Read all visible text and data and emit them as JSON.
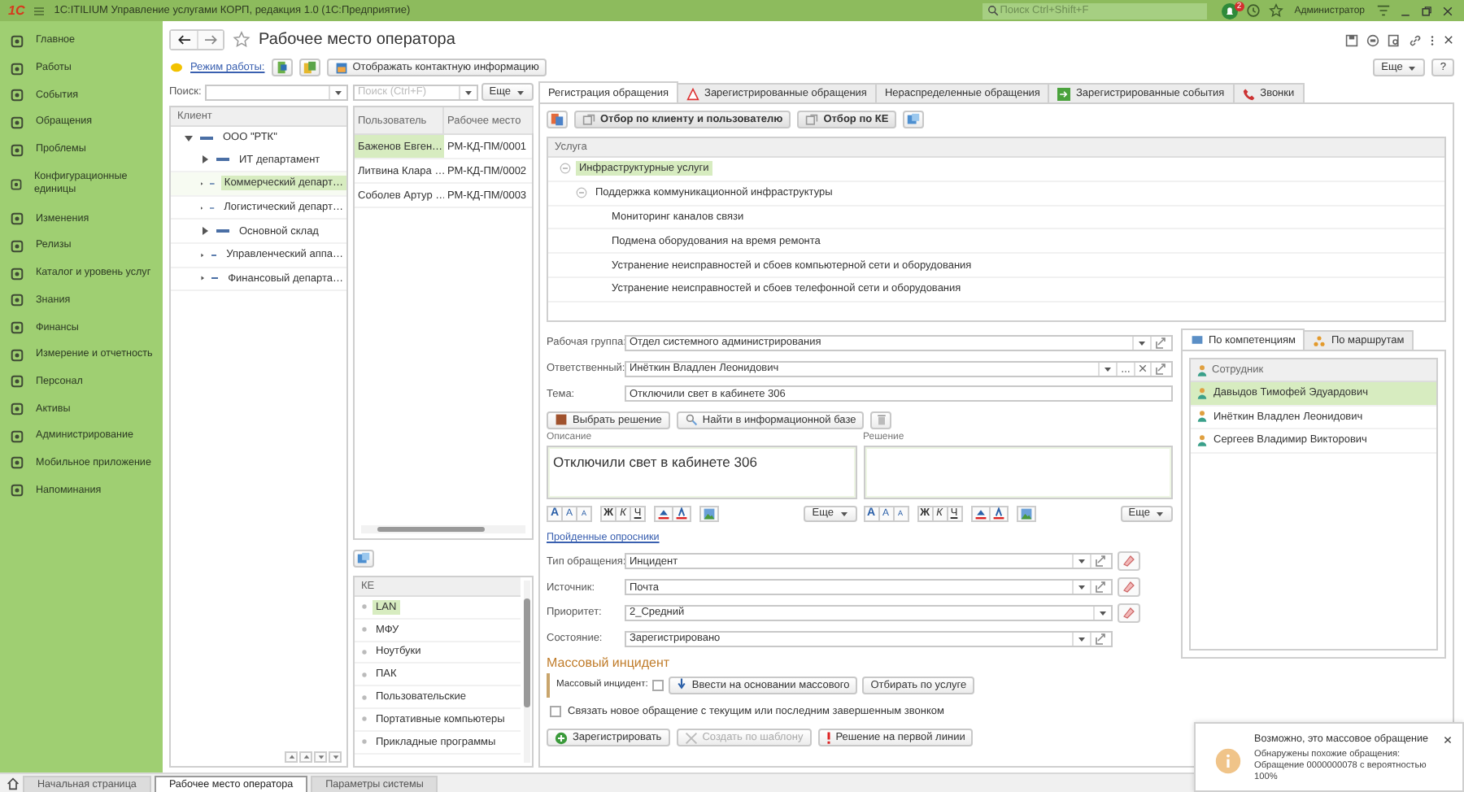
{
  "app_bar": {
    "logo": "1С",
    "title": "1С:ITILIUM Управление услугами КОРП, редакция 1.0  (1С:Предприятие)",
    "search": {
      "placeholder": "Поиск Ctrl+Shift+F"
    },
    "notification_count": "2",
    "user": "Администратор"
  },
  "sidebar": {
    "items": [
      {
        "label": "Главное"
      },
      {
        "label": "Работы"
      },
      {
        "label": "События"
      },
      {
        "label": "Обращения"
      },
      {
        "label": "Проблемы"
      },
      {
        "label": "Конфигурационные единицы"
      },
      {
        "label": "Изменения"
      },
      {
        "label": "Релизы"
      },
      {
        "label": "Каталог и уровень услуг"
      },
      {
        "label": "Знания"
      },
      {
        "label": "Финансы"
      },
      {
        "label": "Измерение и отчетность"
      },
      {
        "label": "Персонал"
      },
      {
        "label": "Активы"
      },
      {
        "label": "Администрирование"
      },
      {
        "label": "Мобильное приложение"
      },
      {
        "label": "Напоминания"
      }
    ]
  },
  "form": {
    "title": "Рабочее место оператора",
    "mode_link": "Режим работы:",
    "contact_button": "Отображать контактную информацию",
    "more_button": "Еще",
    "help_button": "?"
  },
  "clients": {
    "search_label": "Поиск:",
    "column": "Клиент",
    "tree": [
      {
        "label": "ООО \"РТК\"",
        "expanded": true,
        "selected": false,
        "children": [
          {
            "label": "ИТ департамент",
            "expanded": false,
            "selected": false
          },
          {
            "label": "Коммерческий департ…",
            "expanded": false,
            "selected": true
          },
          {
            "label": "Логистический департ…",
            "expanded": false,
            "selected": false
          },
          {
            "label": "Основной склад",
            "expanded": false,
            "selected": false
          },
          {
            "label": "Управленческий аппа…",
            "expanded": false,
            "selected": false
          },
          {
            "label": "Финансовый департа…",
            "expanded": false,
            "selected": false
          }
        ]
      }
    ]
  },
  "users": {
    "search": {
      "placeholder": "Поиск (Ctrl+F)"
    },
    "more_button": "Еще",
    "columns": [
      "Пользователь",
      "Рабочее место"
    ],
    "rows": [
      {
        "cells": [
          "Баженов Евген…",
          "РМ-КД-ПМ/0001"
        ],
        "selected": true
      },
      {
        "cells": [
          "Литвина Клара …",
          "РМ-КД-ПМ/0002"
        ],
        "selected": false
      },
      {
        "cells": [
          "Соболев Артур …",
          "РМ-КД-ПМ/0003"
        ],
        "selected": false
      }
    ]
  },
  "ke_list": {
    "column": "КЕ",
    "items": [
      {
        "label": "LAN",
        "selected": true
      },
      {
        "label": "МФУ",
        "selected": false
      },
      {
        "label": "Ноутбуки",
        "selected": false
      },
      {
        "label": "ПАК",
        "selected": false
      },
      {
        "label": "Пользовательские",
        "selected": false
      },
      {
        "label": "Портативные компьютеры",
        "selected": false
      },
      {
        "label": "Прикладные программы",
        "selected": false
      }
    ]
  },
  "tabs": [
    {
      "label": "Регистрация обращения",
      "selected": true,
      "kind": "plain"
    },
    {
      "label": "Зарегистрированные обращения",
      "selected": false,
      "kind": "warning"
    },
    {
      "label": "Нераспределенные обращения",
      "selected": false,
      "kind": "plain"
    },
    {
      "label": "Зарегистрированные события",
      "selected": false,
      "kind": "event"
    },
    {
      "label": "Звонки",
      "selected": false,
      "kind": "phone"
    }
  ],
  "filter_buttons": [
    "Отбор по клиенту и пользователю",
    "Отбор по КЕ"
  ],
  "services": {
    "column": "Услуга",
    "tree": [
      {
        "label": "Инфраструктурные услуги",
        "selected": true,
        "expanded": true,
        "children": [
          {
            "label": "Поддержка коммуникационной инфраструктуры",
            "selected": false,
            "expanded": true,
            "children": [
              {
                "label": "Мониторинг каналов связи",
                "selected": false
              },
              {
                "label": "Подмена оборудования на время ремонта",
                "selected": false
              },
              {
                "label": "Устранение неисправностей и сбоев компьютерной сети и оборудования",
                "selected": false
              },
              {
                "label": "Устранение неисправностей и сбоев телефонной сети и оборудования",
                "selected": false
              }
            ]
          }
        ]
      }
    ]
  },
  "fields": [
    {
      "label": "Рабочая группа:",
      "value": "Отдел системного администрирования",
      "kind": "select"
    },
    {
      "label": "Ответственный:",
      "value": "Инёткин Владлен Леонидович",
      "kind": "select"
    },
    {
      "label": "Тема:",
      "value": "Отключили свет в кабинете 306",
      "kind": "text"
    }
  ],
  "action_buttons": [
    "Выбрать решение",
    "Найти в информационной базе"
  ],
  "editors": [
    {
      "label": "Описание",
      "value": "Отключили свет в кабинете 306",
      "format_buttons": [
        "A",
        "A",
        "A",
        "Ж",
        "К",
        "Ч"
      ],
      "more_button": "Еще"
    },
    {
      "label": "Решение",
      "format_buttons": [
        "A",
        "A",
        "A",
        "Ж",
        "К",
        "Ч"
      ],
      "more_button": "Еще"
    }
  ],
  "survey_link": "Пройденные опросники",
  "classification": [
    {
      "label": "Тип обращения:",
      "value": "Инцидент"
    },
    {
      "label": "Источник:",
      "value": "Почта"
    },
    {
      "label": "Приоритет:",
      "value": "2_Средний"
    },
    {
      "label": "Состояние:",
      "value": "Зарегистрировано"
    }
  ],
  "mass_incident": {
    "title": "Массовый инцидент",
    "checkbox_label": "Массовый инцидент:",
    "checked": false,
    "buttons": [
      "Ввести на основании массового",
      "Отбирать по услуге"
    ]
  },
  "link_call": {
    "label": "Связать новое обращение с текущим или последним завершенным звонком",
    "checked": false
  },
  "footer_buttons": [
    {
      "label": "Зарегистрировать",
      "disabled": false,
      "kind": "add"
    },
    {
      "label": "Создать по шаблону",
      "disabled": true,
      "kind": "template"
    },
    {
      "label": "Решение на первой линии",
      "disabled": false,
      "kind": "alert"
    }
  ],
  "assignee_tabs": [
    {
      "label": "По компетенциям",
      "selected": true
    },
    {
      "label": "По маршрутам",
      "selected": false
    }
  ],
  "employees": {
    "column": "Сотрудник",
    "rows": [
      {
        "name": "Давыдов Тимофей Эдуардович",
        "selected": true
      },
      {
        "name": "Инёткин Владлен Леонидович",
        "selected": false
      },
      {
        "name": "Сергеев Владимир Викторович",
        "selected": false
      }
    ]
  },
  "notification": {
    "title": "Возможно, это массовое обращение",
    "text": "Обнаружены похожие обращения: Обращение 0000000078 с вероятностью 100%"
  },
  "page_tabs": [
    {
      "label": "Начальная страница",
      "selected": false
    },
    {
      "label": "Рабочее место оператора",
      "selected": true
    },
    {
      "label": "Параметры системы",
      "selected": false
    }
  ]
}
